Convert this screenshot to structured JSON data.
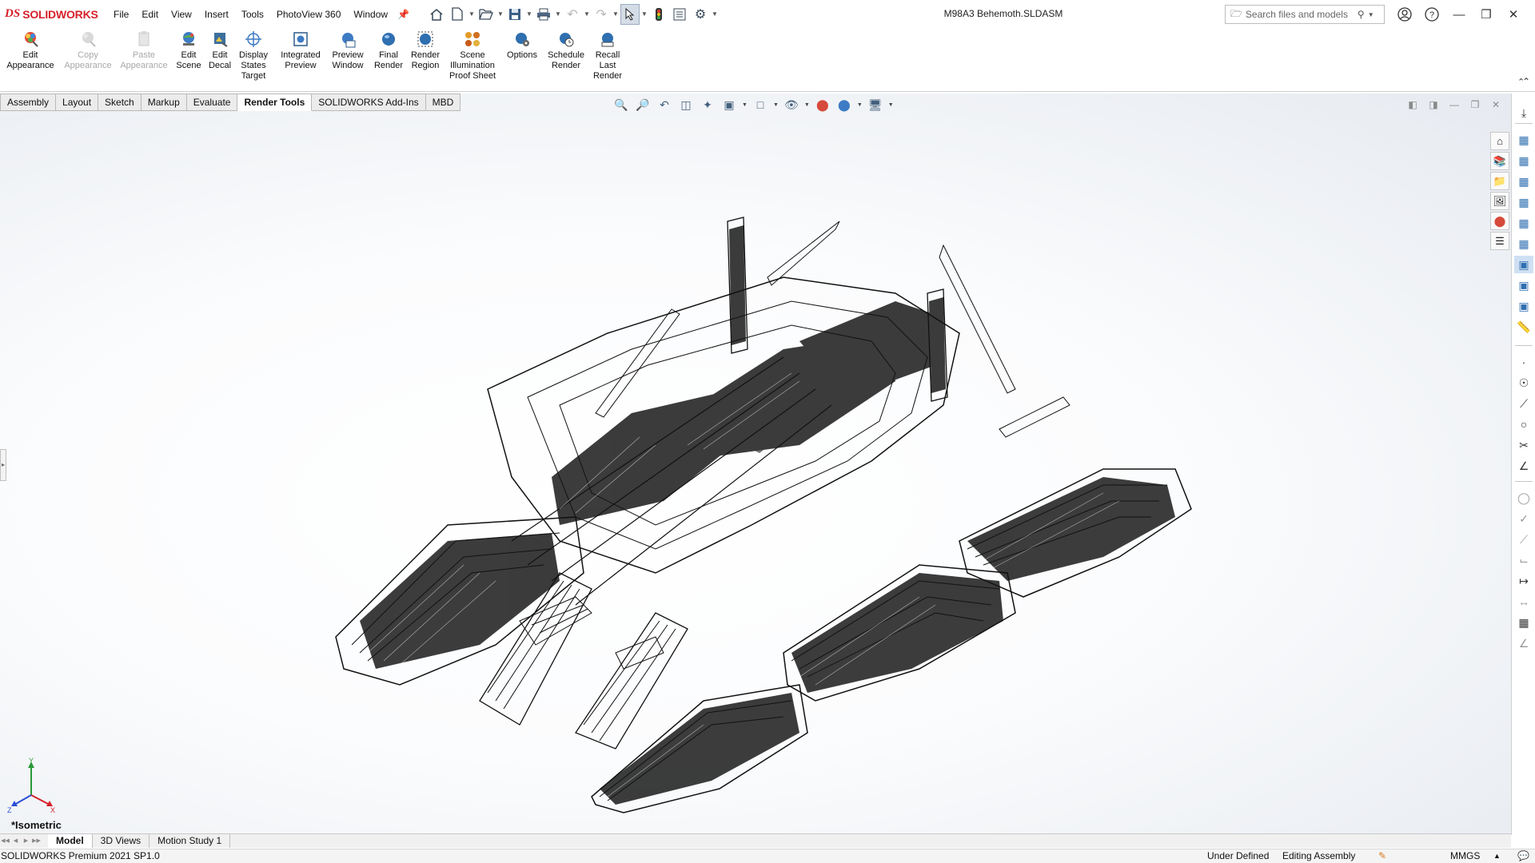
{
  "app": {
    "logo_mark": "DS",
    "logo_text": "SOLIDWORKS",
    "document_title": "M98A3 Behemoth.SLDASM"
  },
  "menu": [
    "File",
    "Edit",
    "View",
    "Insert",
    "Tools",
    "PhotoView 360",
    "Window"
  ],
  "quick_access": [
    "home-icon",
    "new-document-icon",
    "open-icon",
    "save-icon",
    "print-icon",
    "undo-icon",
    "redo-icon",
    "select-pointer-icon",
    "rebuild-icon",
    "file-properties-icon",
    "options-gear-icon"
  ],
  "search": {
    "placeholder": "Search files and models"
  },
  "ribbon": {
    "buttons": [
      {
        "label": "Edit\nAppearance",
        "icon": "edit-appearance-icon",
        "enabled": true
      },
      {
        "label": "Copy\nAppearance",
        "icon": "copy-appearance-icon",
        "enabled": false
      },
      {
        "label": "Paste\nAppearance",
        "icon": "paste-appearance-icon",
        "enabled": false
      },
      {
        "label": "Edit\nScene",
        "icon": "edit-scene-icon",
        "enabled": true
      },
      {
        "label": "Edit\nDecal",
        "icon": "edit-decal-icon",
        "enabled": true
      },
      {
        "label": "Display\nStates\nTarget",
        "icon": "display-states-target-icon",
        "enabled": true
      },
      {
        "label": "Integrated\nPreview",
        "icon": "integrated-preview-icon",
        "enabled": true
      },
      {
        "label": "Preview\nWindow",
        "icon": "preview-window-icon",
        "enabled": true
      },
      {
        "label": "Final\nRender",
        "icon": "final-render-icon",
        "enabled": true
      },
      {
        "label": "Render\nRegion",
        "icon": "render-region-icon",
        "enabled": true
      },
      {
        "label": "Scene\nIllumination\nProof Sheet",
        "icon": "scene-illumination-icon",
        "enabled": true
      },
      {
        "label": "Options",
        "icon": "render-options-icon",
        "enabled": true
      },
      {
        "label": "Schedule\nRender",
        "icon": "schedule-render-icon",
        "enabled": true
      },
      {
        "label": "Recall\nLast\nRender",
        "icon": "recall-last-render-icon",
        "enabled": true
      }
    ]
  },
  "command_tabs": [
    "Assembly",
    "Layout",
    "Sketch",
    "Markup",
    "Evaluate",
    "Render Tools",
    "SOLIDWORKS Add-Ins",
    "MBD"
  ],
  "active_command_tab": "Render Tools",
  "viewport": {
    "view_orientation_label": "*Isometric",
    "triad": {
      "x": "X",
      "y": "Y",
      "z": "Z"
    },
    "display_style": "wireframe"
  },
  "bottom_tabs": [
    "Model",
    "3D Views",
    "Motion Study 1"
  ],
  "active_bottom_tab": "Model",
  "status": {
    "product": "SOLIDWORKS Premium 2021 SP1.0",
    "definition": "Under Defined",
    "mode": "Editing Assembly",
    "units": "MMGS"
  },
  "colors": {
    "brand_red": "#d6202a",
    "accent_blue": "#2f6fb0"
  }
}
